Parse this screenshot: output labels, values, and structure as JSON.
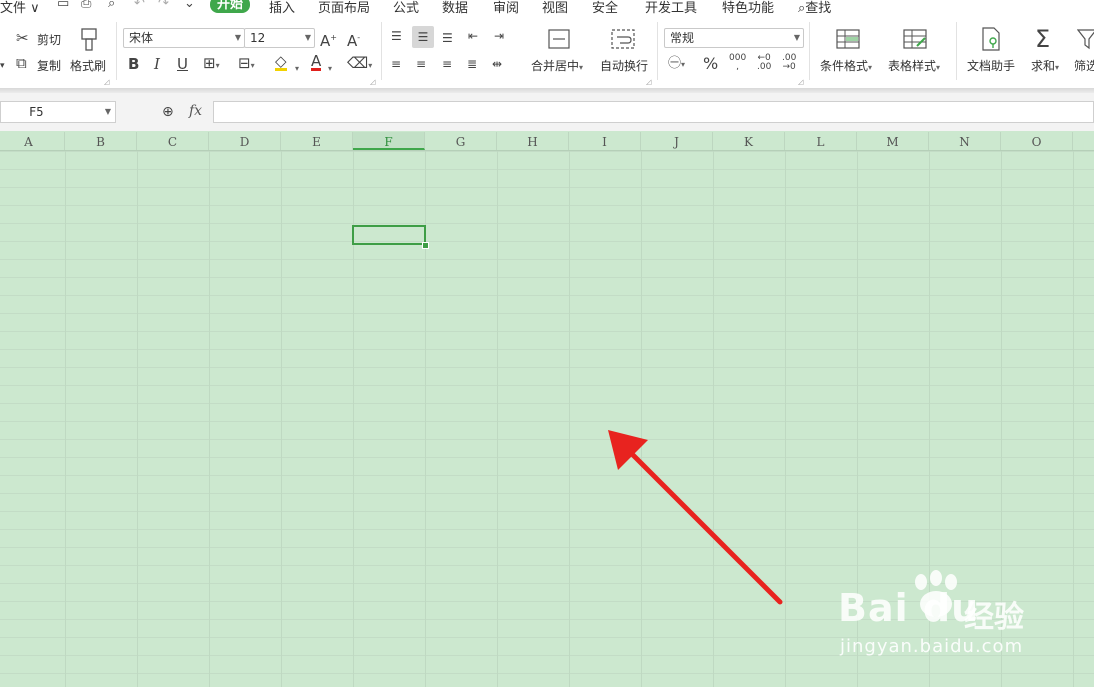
{
  "tabbar": {
    "file": "文件 ∨",
    "tabs": [
      "开始",
      "插入",
      "页面布局",
      "公式",
      "数据",
      "审阅",
      "视图",
      "安全",
      "开发工具",
      "特色功能"
    ],
    "search": "查找"
  },
  "clipboard": {
    "cut": "剪切",
    "copy": "复制",
    "format_painter": "格式刷"
  },
  "font": {
    "name": "宋体",
    "size": "12"
  },
  "alignment": {
    "merge_center": "合并居中",
    "wrap_text": "自动换行"
  },
  "number": {
    "format": "常规"
  },
  "styles": {
    "conditional_format": "条件格式",
    "table_style": "表格样式"
  },
  "tools": {
    "doc_assistant": "文档助手",
    "sum": "求和",
    "filter": "筛选"
  },
  "formula_bar": {
    "cell_ref": "F5",
    "fx": "fx",
    "value": ""
  },
  "columns": [
    "A",
    "B",
    "C",
    "D",
    "E",
    "F",
    "G",
    "H",
    "I",
    "J",
    "K",
    "L",
    "M",
    "N",
    "O"
  ],
  "selected_column": "F",
  "selected_cell": "F5",
  "colors": {
    "accent": "#3fa74b",
    "sheet_background": "#cce8cf",
    "arrow": "#e8231f"
  },
  "watermark": {
    "logo": "Bai du",
    "cn": "经验",
    "url": "jingyan.baidu.com"
  }
}
